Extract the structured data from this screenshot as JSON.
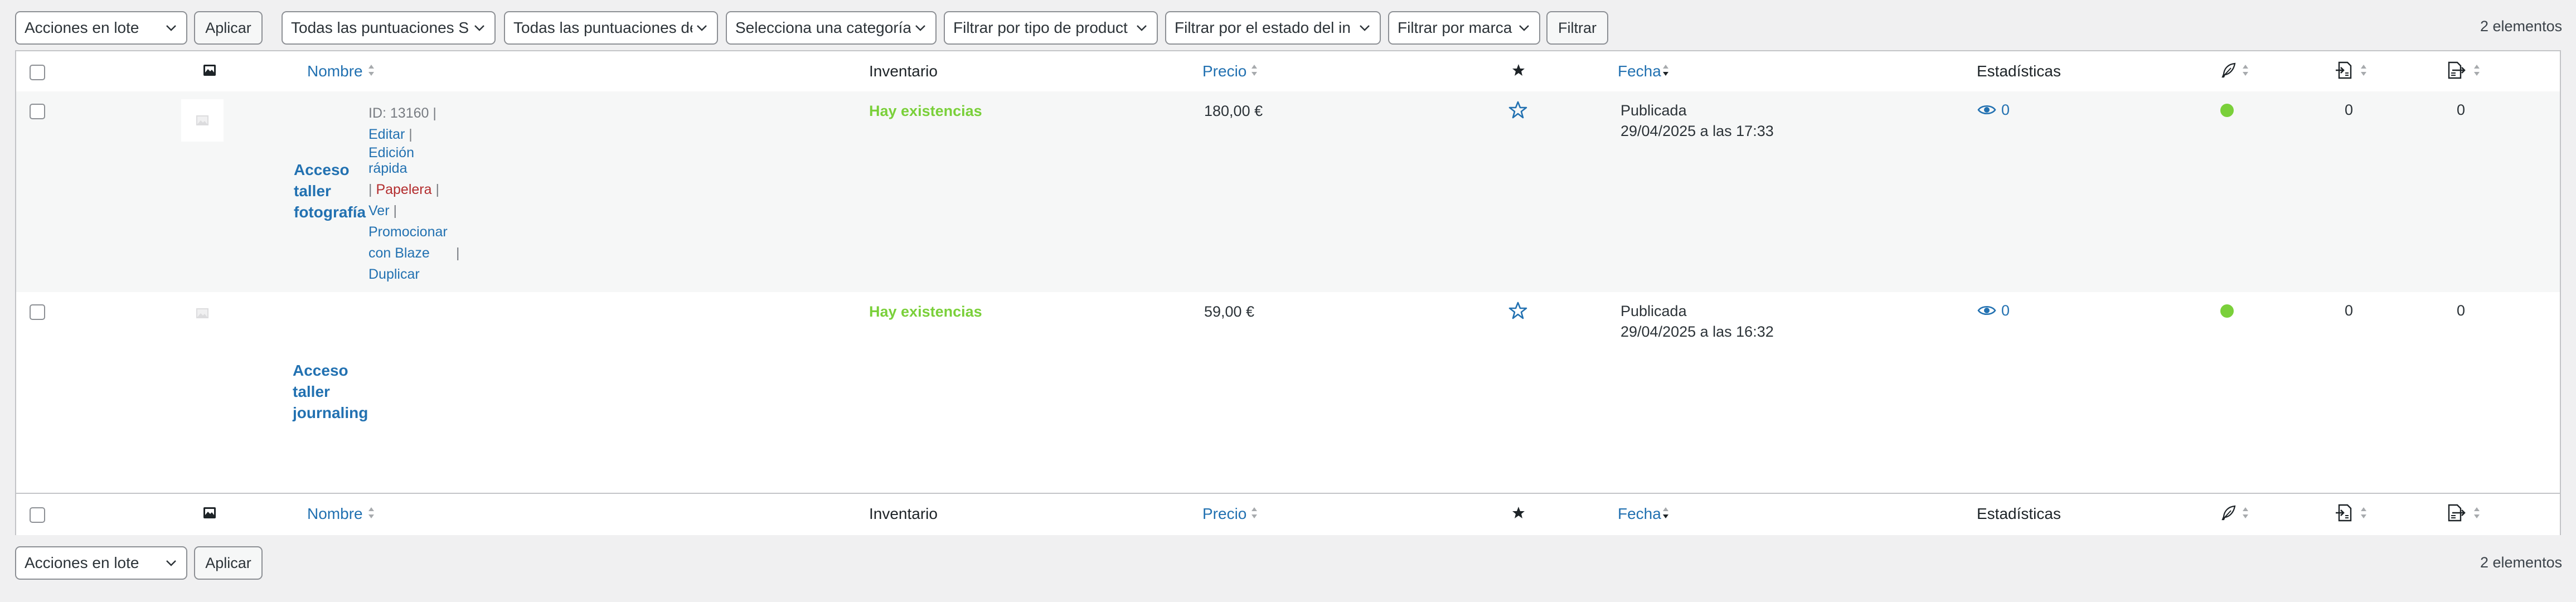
{
  "top_bar": {
    "bulk_actions": "Acciones en lote",
    "apply": "Aplicar",
    "filters": [
      "Todas las puntuaciones SE",
      "Todas las puntuaciones de",
      "Selecciona una categoría",
      "Filtrar por tipo de product",
      "Filtrar por el estado del in",
      "Filtrar por marca"
    ],
    "filter_button": "Filtrar",
    "count": "2 elementos"
  },
  "columns": {
    "name": "Nombre",
    "inventory": "Inventario",
    "price": "Precio",
    "date": "Fecha",
    "stats": "Estadísticas"
  },
  "icons": {
    "thumb_column": "image-icon",
    "featured_column": "star-icon",
    "seo_column": "feather-icon",
    "inbound_column": "page-in-icon",
    "outbound_column": "page-out-icon",
    "views": "eye-icon",
    "featured_toggle": "star-outline-icon",
    "placeholder": "image-placeholder-icon"
  },
  "colors": {
    "link": "#2271b1",
    "in_stock": "#7ad03a",
    "trash": "#b32d2e",
    "seo_ok": "#7ad03a"
  },
  "products": [
    {
      "name": "Acceso taller fotografía",
      "id_label": "ID: 13160",
      "actions": {
        "edit": "Editar",
        "quick_edit": "Edición rápida",
        "trash": "Papelera",
        "view": "Ver",
        "promote": "Promocionar con Blaze",
        "duplicate": "Duplicar"
      },
      "stock": "Hay existencias",
      "price": "180,00 €",
      "status": "Publicada",
      "date": "29/04/2025 a las 17:33",
      "views": "0",
      "inbound": "0",
      "outbound": "0"
    },
    {
      "name": "Acceso taller journaling",
      "stock": "Hay existencias",
      "price": "59,00 €",
      "status": "Publicada",
      "date": "29/04/2025 a las 16:32",
      "views": "0",
      "inbound": "0",
      "outbound": "0"
    }
  ],
  "bottom_bar": {
    "bulk_actions": "Acciones en lote",
    "apply": "Aplicar",
    "count": "2 elementos"
  }
}
